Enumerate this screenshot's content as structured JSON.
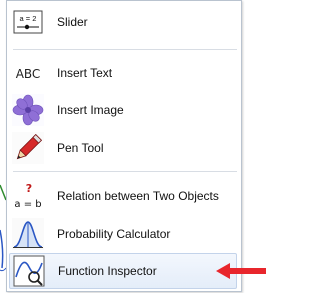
{
  "menu": {
    "items": [
      {
        "label": "Slider",
        "icon": "slider-icon"
      },
      {
        "label": "Insert Text",
        "icon": "text-abc-icon"
      },
      {
        "label": "Insert Image",
        "icon": "image-flower-icon"
      },
      {
        "label": "Pen Tool",
        "icon": "pen-icon"
      },
      {
        "label": "Relation between Two Objects",
        "icon": "relation-icon"
      },
      {
        "label": "Probability Calculator",
        "icon": "probability-icon"
      },
      {
        "label": "Function Inspector",
        "icon": "function-inspector-icon"
      }
    ],
    "slider_icon_text": "a = 2",
    "text_icon_text": "ABC",
    "relation_icon_top": "?",
    "relation_icon_bottom": "a = b"
  },
  "colors": {
    "arrow": "#e8262c",
    "selection": "#e4edf9",
    "flower": "#8f6fd6"
  }
}
